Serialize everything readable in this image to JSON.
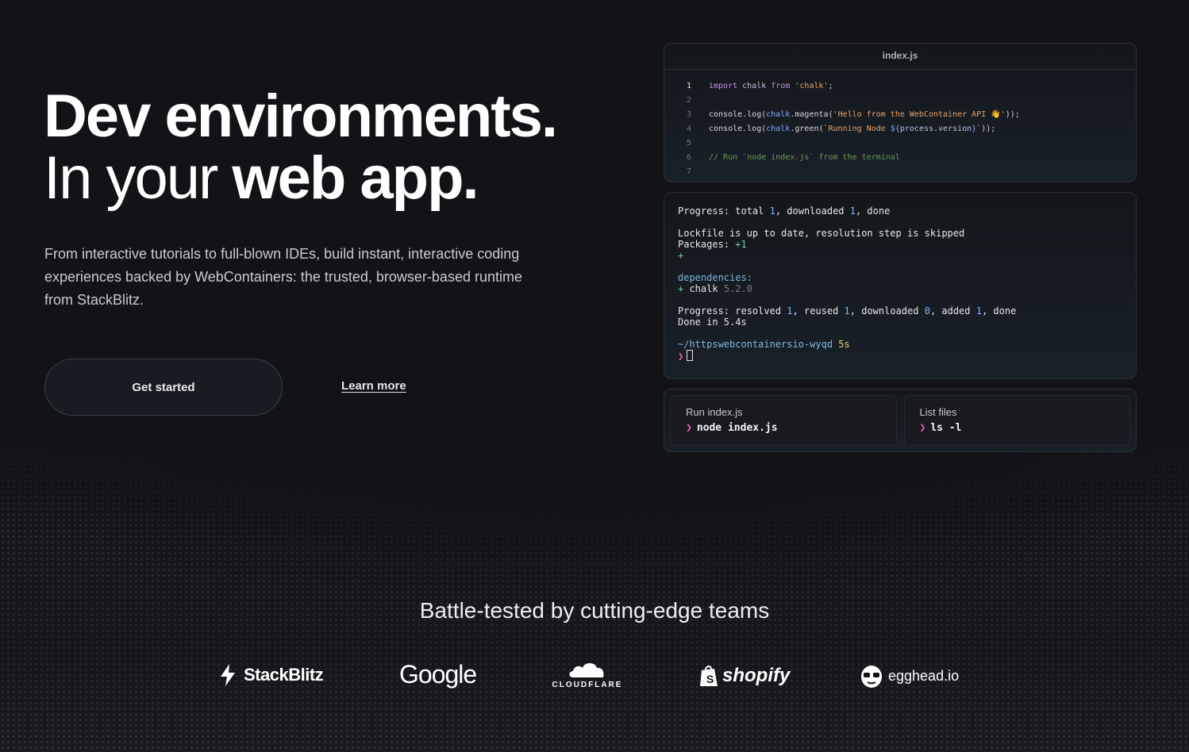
{
  "hero": {
    "title_line1": "Dev environments.",
    "title_line2_light": "In your",
    "title_line2_bold": "web app.",
    "subtitle": "From interactive tutorials to full-blown IDEs, build instant, interactive coding experiences backed by WebContainers: the trusted, browser-based runtime from StackBlitz.",
    "primary_button": "Get started",
    "secondary_link": "Learn more"
  },
  "editor": {
    "filename": "index.js",
    "line_numbers": [
      "1",
      "2",
      "3",
      "4",
      "5",
      "6",
      "7"
    ],
    "line1": {
      "kw1": "import",
      "id": " chalk ",
      "kw2": "from",
      "str": " 'chalk'",
      "end": ";"
    },
    "line3": {
      "pre": "console.log(",
      "id": "chalk",
      "mid": ".magenta(",
      "str": "'Hello from the WebContainer API 👋'",
      "end": "));"
    },
    "line4": {
      "pre": "console.log(",
      "id": "chalk",
      "mid": ".green(",
      "str": "`Running Node ",
      "var_open": "${",
      "var": "process.version",
      "var_close": "}",
      "str_end": "`",
      "end": "));"
    },
    "line6": {
      "comment": "// Run `node index.js` from the terminal"
    }
  },
  "terminal": {
    "l1": {
      "a": "Progress: total ",
      "n1": "1",
      "b": ", downloaded ",
      "n2": "1",
      "c": ", done"
    },
    "l2": "Lockfile is up to date, resolution step is skipped",
    "l3": {
      "a": "Packages: ",
      "b": "+1"
    },
    "l4": "+",
    "l5": "dependencies:",
    "l6": {
      "plus": "+",
      "pkg": " chalk ",
      "ver": "5.2.0"
    },
    "l7": {
      "a": "Progress: resolved ",
      "n1": "1",
      "b": ", reused ",
      "n2": "1",
      "c": ", downloaded ",
      "n3": "0",
      "d": ", added ",
      "n4": "1",
      "e": ", done"
    },
    "l8": "Done in 5.4s",
    "l9": {
      "path": "~/httpswebcontainersio-wyqd",
      "time": " 5s"
    },
    "prompt": "❯"
  },
  "commands": [
    {
      "label": "Run index.js",
      "prompt": "❯",
      "code": "node index.js"
    },
    {
      "label": "List files",
      "prompt": "❯",
      "code": "ls -l"
    }
  ],
  "teams": {
    "title": "Battle-tested by cutting-edge teams",
    "logos": [
      "StackBlitz",
      "Google",
      "CLOUDFLARE",
      "shopify",
      "egghead.io"
    ]
  }
}
